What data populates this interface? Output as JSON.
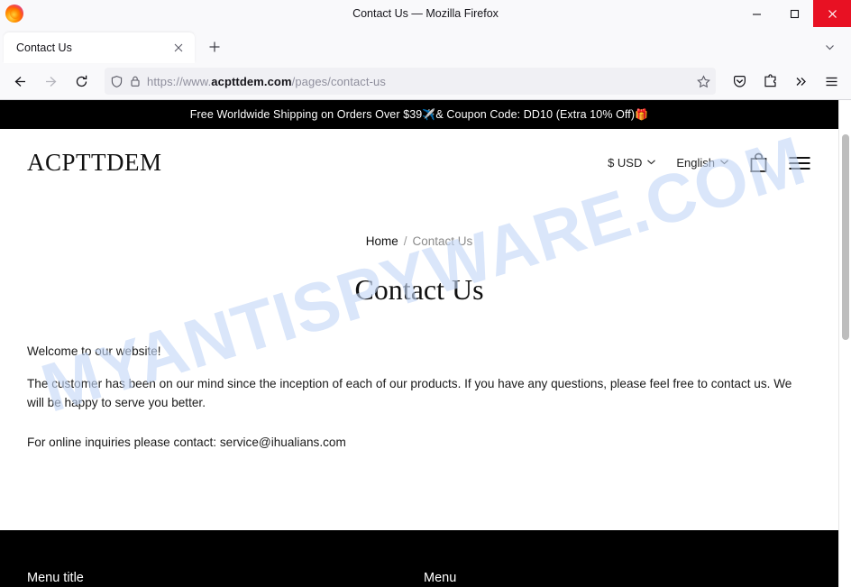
{
  "browser": {
    "window_title": "Contact Us — Mozilla Firefox",
    "tab_title": "Contact Us",
    "new_tab_label": "+",
    "url_prefix": "https://www.",
    "url_domain": "acpttdem.com",
    "url_path": "/pages/contact-us",
    "full_url": "https://www.acpttdem.com/pages/contact-us",
    "icons": {
      "firefox_logo": "firefox-logo",
      "tab_close": "close-icon",
      "tab_list": "chevron-down-icon",
      "back": "back-arrow-icon",
      "forward": "forward-arrow-icon",
      "reload": "reload-icon",
      "shield": "shield-icon",
      "lock": "lock-icon",
      "bookmark": "star-icon",
      "pocket": "pocket-icon",
      "extensions": "extensions-icon",
      "overflow": "chevron-double-right-icon",
      "app_menu": "hamburger-menu-icon",
      "minimize": "minimize-icon",
      "maximize": "maximize-icon",
      "close": "close-icon"
    }
  },
  "site": {
    "announcement": "Free Worldwide Shipping on Orders Over $39",
    "announcement_emoji_1": "✈️",
    "announcement_mid": " & Coupon Code: DD10 (Extra 10% Off)",
    "announcement_emoji_2": "🎁",
    "logo": "ACPTTDEM",
    "currency": "$ USD",
    "language": "English",
    "cart_icon": "shopping-bag-icon",
    "menu_icon": "hamburger-menu-icon",
    "chevron_icon": "chevron-down-icon"
  },
  "breadcrumb": {
    "home": "Home",
    "separator": "/",
    "current": "Contact Us"
  },
  "main": {
    "title": "Contact Us",
    "paragraph_1": "Welcome to our website!",
    "paragraph_2": "The customer has been on our mind since the inception of each of our products. If you have any questions, please feel free to contact us. We will be happy to serve you better.",
    "paragraph_3": "For online inquiries please contact: service@ihualians.com"
  },
  "footer": {
    "col_1_heading": "Menu title",
    "col_2_heading": "Menu"
  },
  "watermark": {
    "text": "MYANTISPYWARE.COM",
    "color": "#c5d8f7"
  }
}
